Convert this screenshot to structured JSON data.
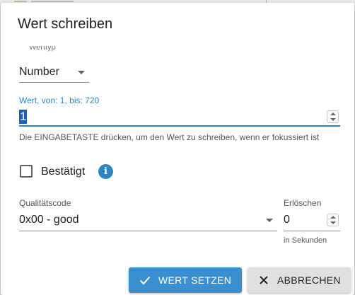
{
  "dialog": {
    "title": "Wert schreiben"
  },
  "type_select": {
    "label": "Werttyp",
    "value": "Number"
  },
  "value_field": {
    "label": "Wert, von: 1, bis: 720",
    "value": "1",
    "helper": "Die EINGABETASTE drücken, um den Wert zu schreiben, wenn er fokussiert ist"
  },
  "ack": {
    "label": "Bestätigt",
    "checked": false,
    "info_icon": "info-icon"
  },
  "quality": {
    "label": "Qualitätscode",
    "value": "0x00 - good"
  },
  "expire": {
    "label": "Erlöschen",
    "value": "0",
    "helper": "in Sekunden"
  },
  "buttons": {
    "set_label": "WERT SETZEN",
    "set_icon": "check-icon",
    "cancel_label": "ABBRECHEN",
    "cancel_icon": "close-icon"
  },
  "colors": {
    "accent": "#3a8fd0",
    "focus": "#2e86c1",
    "secondary_button": "#e0e0e0"
  }
}
